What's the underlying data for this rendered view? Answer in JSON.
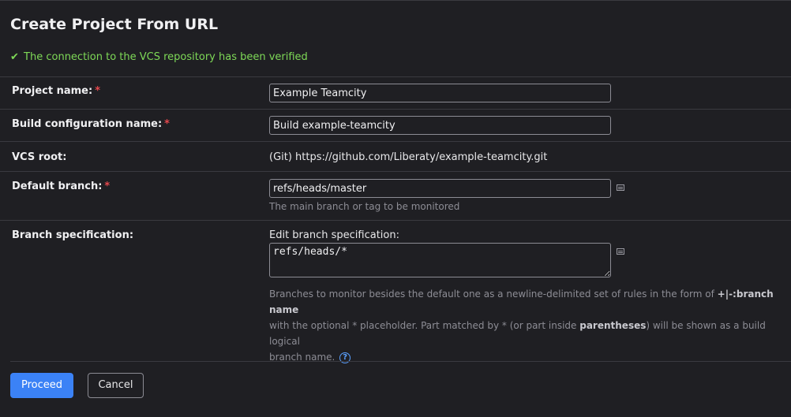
{
  "page": {
    "title": "Create Project From URL",
    "verified_icon": "✔",
    "verified_text": "The connection to the VCS repository has been verified"
  },
  "form": {
    "project_name": {
      "label": "Project name:",
      "required_mark": "*",
      "value": "Example Teamcity"
    },
    "build_config_name": {
      "label": "Build configuration name:",
      "required_mark": "*",
      "value": "Build example-teamcity"
    },
    "vcs_root": {
      "label": "VCS root:",
      "value": "(Git) https://github.com/Liberaty/example-teamcity.git"
    },
    "default_branch": {
      "label": "Default branch:",
      "required_mark": "*",
      "value": "refs/heads/master",
      "hint": "The main branch or tag to be monitored",
      "icon": "list-icon"
    },
    "branch_spec": {
      "label": "Branch specification:",
      "edit_label": "Edit branch specification:",
      "value": "refs/heads/*",
      "icon": "list-icon",
      "hint_part1": "Branches to monitor besides the default one as a newline-delimited set of rules in the form of ",
      "hint_bold1": "+|-:branch name",
      "hint_part2": "with the optional * placeholder. Part matched by * (or part inside ",
      "hint_bold2": "parentheses",
      "hint_part3": ") will be shown as a build logical",
      "hint_part4": "branch name.",
      "help_icon": "?"
    }
  },
  "buttons": {
    "proceed": "Proceed",
    "cancel": "Cancel"
  },
  "colors": {
    "accent": "#3b82f6",
    "success": "#7ed957",
    "required": "#e5484d",
    "background": "#1f1f23"
  }
}
